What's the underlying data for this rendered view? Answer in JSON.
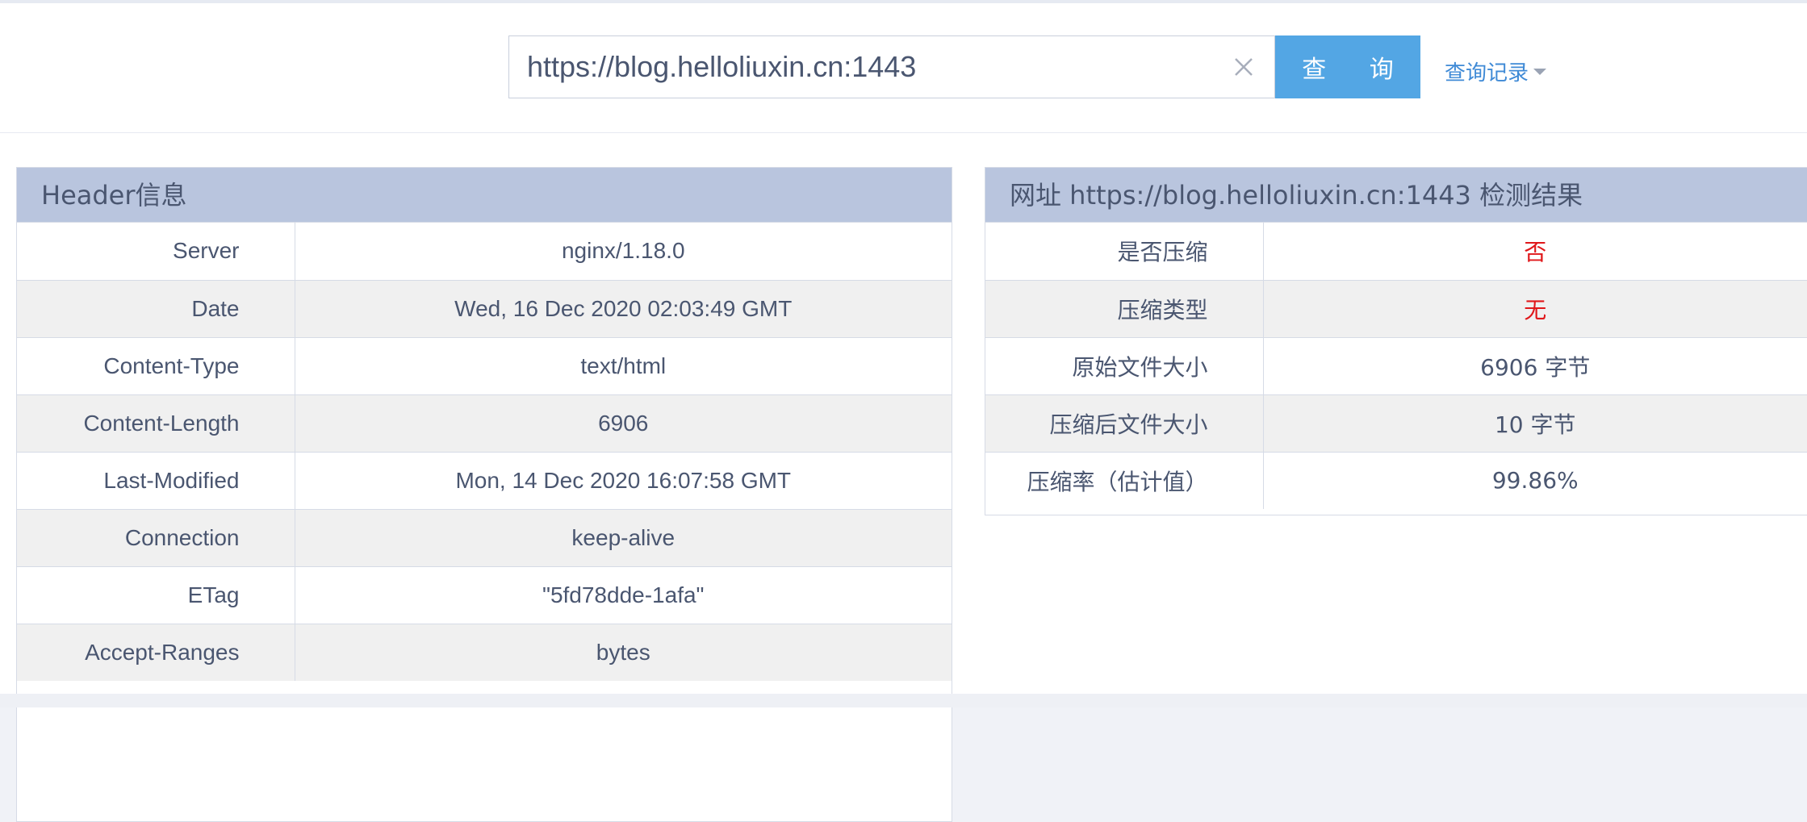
{
  "search": {
    "value": "https://blog.helloliuxin.cn:1443",
    "query_label": "查 询",
    "history_label": "查询记录"
  },
  "header_panel": {
    "title": "Header信息",
    "rows": [
      {
        "key": "Server",
        "value": "nginx/1.18.0"
      },
      {
        "key": "Date",
        "value": "Wed, 16 Dec 2020 02:03:49 GMT"
      },
      {
        "key": "Content-Type",
        "value": "text/html"
      },
      {
        "key": "Content-Length",
        "value": "6906"
      },
      {
        "key": "Last-Modified",
        "value": "Mon, 14 Dec 2020 16:07:58 GMT"
      },
      {
        "key": "Connection",
        "value": "keep-alive"
      },
      {
        "key": "ETag",
        "value": "\"5fd78dde-1afa\""
      },
      {
        "key": "Accept-Ranges",
        "value": "bytes"
      }
    ]
  },
  "result_panel": {
    "title": "网址 https://blog.helloliuxin.cn:1443 检测结果",
    "rows": [
      {
        "key": "是否压缩",
        "value": "否"
      },
      {
        "key": "压缩类型",
        "value": "无"
      },
      {
        "key": "原始文件大小",
        "value": "6906 字节"
      },
      {
        "key": "压缩后文件大小",
        "value": "10 字节"
      },
      {
        "key": "压缩率（估计值）",
        "value": "99.86%"
      }
    ]
  },
  "colors": {
    "accent": "#53a6e4",
    "panel_header": "#b9c5de",
    "alert": "#e0171a",
    "link": "#3f8ad6"
  }
}
